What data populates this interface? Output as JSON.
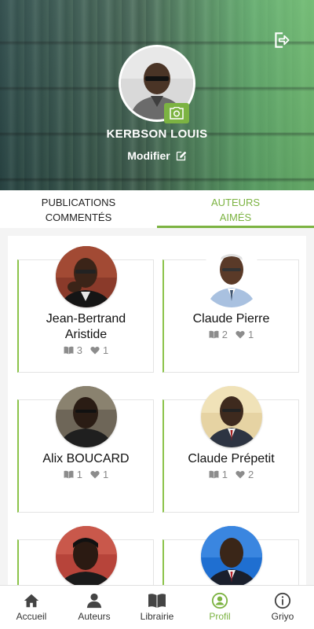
{
  "header": {
    "user_name": "KERBSON LOUIS",
    "modify_label": "Modifier"
  },
  "tabs": [
    {
      "label_line1": "PUBLICATIONS",
      "label_line2": "COMMENTÉS",
      "active": false
    },
    {
      "label_line1": "AUTEURS",
      "label_line2": "AIMÉS",
      "active": true
    }
  ],
  "authors": [
    {
      "name_line1": "Jean-Bertrand",
      "name_line2": "Aristide",
      "books": "3",
      "likes": "1"
    },
    {
      "name_line1": "Claude Pierre",
      "name_line2": "",
      "books": "2",
      "likes": "1"
    },
    {
      "name_line1": "Alix BOUCARD",
      "name_line2": "",
      "books": "1",
      "likes": "1"
    },
    {
      "name_line1": "Claude Prépetit",
      "name_line2": "",
      "books": "1",
      "likes": "2"
    },
    {
      "name_line1": "",
      "name_line2": "",
      "books": "",
      "likes": ""
    },
    {
      "name_line1": "",
      "name_line2": "",
      "books": "",
      "likes": ""
    }
  ],
  "bottom_nav": [
    {
      "label": "Accueil",
      "icon": "home-icon",
      "active": false
    },
    {
      "label": "Auteurs",
      "icon": "person-icon",
      "active": false
    },
    {
      "label": "Librairie",
      "icon": "book-icon",
      "active": false
    },
    {
      "label": "Profil",
      "icon": "profile-icon",
      "active": true
    },
    {
      "label": "Griyo",
      "icon": "info-icon",
      "active": false
    }
  ],
  "colors": {
    "accent": "#7cb342",
    "card_border": "#8bc34a"
  }
}
